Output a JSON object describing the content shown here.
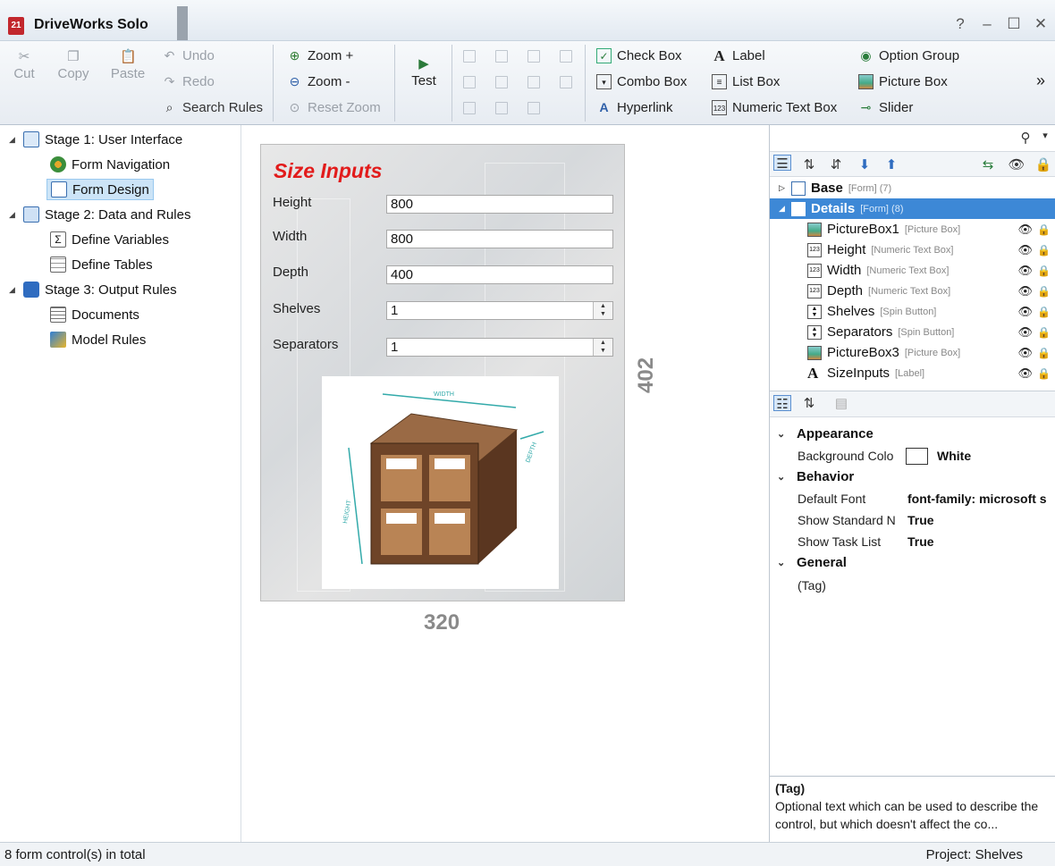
{
  "window": {
    "app_icon_text": "21",
    "title": "DriveWorks Solo",
    "help_glyph": "?",
    "minimize_glyph": "–",
    "maximize_glyph": "☐",
    "close_glyph": "✕"
  },
  "toolbar": {
    "cut": "Cut",
    "copy": "Copy",
    "paste": "Paste",
    "undo": "Undo",
    "redo": "Redo",
    "search_rules": "Search Rules",
    "zoom_in": "Zoom +",
    "zoom_out": "Zoom -",
    "reset_zoom": "Reset Zoom",
    "test": "Test",
    "check_box": "Check Box",
    "combo_box": "Combo Box",
    "hyperlink": "Hyperlink",
    "label": "Label",
    "list_box": "List Box",
    "numeric_text_box": "Numeric Text Box",
    "option_group": "Option Group",
    "picture_box": "Picture Box",
    "slider": "Slider",
    "more": "»"
  },
  "tree": [
    {
      "label": "Stage 1: User Interface",
      "icon": "monitor-icon",
      "level": 0
    },
    {
      "label": "Form Navigation",
      "icon": "navigation-icon",
      "level": 1
    },
    {
      "label": "Form Design",
      "icon": "form-design-icon",
      "level": 1,
      "selected": true
    },
    {
      "label": "Stage 2: Data and Rules",
      "icon": "data-icon",
      "level": 0
    },
    {
      "label": "Define Variables",
      "icon": "sigma-icon",
      "level": 1
    },
    {
      "label": "Define Tables",
      "icon": "table-icon",
      "level": 1
    },
    {
      "label": "Stage 3: Output Rules",
      "icon": "output-icon",
      "level": 0
    },
    {
      "label": "Documents",
      "icon": "documents-icon",
      "level": 1
    },
    {
      "label": "Model Rules",
      "icon": "model-rules-icon",
      "level": 1
    }
  ],
  "form": {
    "title": "Size Inputs",
    "fields": {
      "height_label": "Height",
      "height_value": "800",
      "width_label": "Width",
      "width_value": "800",
      "depth_label": "Depth",
      "depth_value": "400",
      "shelves_label": "Shelves",
      "shelves_value": "1",
      "separators_label": "Separators",
      "separators_value": "1"
    },
    "picture_labels": {
      "width": "WIDTH",
      "height": "HEIGHT",
      "depth": "DEPTH"
    },
    "dim_height": "402",
    "dim_width": "320"
  },
  "controls": {
    "header_glyph": "▾",
    "items": [
      {
        "name": "Base",
        "type": "[Form] (7)",
        "bold": true,
        "expander": "▷",
        "icon": "form-icon"
      },
      {
        "name": "Details",
        "type": "[Form] (8)",
        "bold": true,
        "expander": "◢",
        "icon": "form-icon",
        "selected": true
      },
      {
        "name": "PictureBox1",
        "type": "[Picture Box]",
        "icon": "picture-box-icon"
      },
      {
        "name": "Height",
        "type": "[Numeric Text Box]",
        "icon": "numeric-text-box-icon"
      },
      {
        "name": "Width",
        "type": "[Numeric Text Box]",
        "icon": "numeric-text-box-icon"
      },
      {
        "name": "Depth",
        "type": "[Numeric Text Box]",
        "icon": "numeric-text-box-icon"
      },
      {
        "name": "Shelves",
        "type": "[Spin Button]",
        "icon": "spin-button-icon"
      },
      {
        "name": "Separators",
        "type": "[Spin Button]",
        "icon": "spin-button-icon"
      },
      {
        "name": "PictureBox3",
        "type": "[Picture Box]",
        "icon": "picture-box-icon"
      },
      {
        "name": "SizeInputs",
        "type": "[Label]",
        "icon": "label-icon"
      }
    ]
  },
  "properties": {
    "appearance": "Appearance",
    "background_color_name": "Background Colo",
    "background_color_value": "White",
    "behavior": "Behavior",
    "default_font_name": "Default Font",
    "default_font_value": "font-family: microsoft s",
    "show_standard_name": "Show Standard N",
    "show_standard_value": "True",
    "show_task_list_name": "Show Task List",
    "show_task_list_value": "True",
    "general": "General",
    "tag_name": "(Tag)",
    "tag_value": ""
  },
  "help": {
    "title": "(Tag)",
    "text": "Optional text which can be used to describe the control, but which doesn't affect the co..."
  },
  "status": {
    "left": "8 form control(s) in total",
    "right": "Project: Shelves"
  },
  "colors": {
    "accent": "#3d88d6",
    "form_title": "#e21b1b",
    "tree_selection": "#cce4f7"
  }
}
